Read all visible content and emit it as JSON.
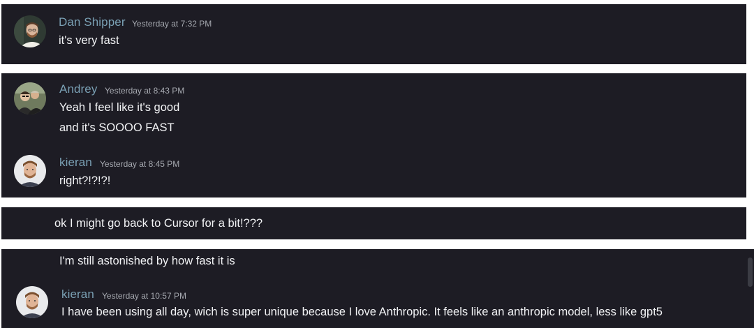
{
  "messages": [
    {
      "author": "Dan Shipper",
      "time": "Yesterday at 7:32 PM",
      "lines": [
        "it's very fast"
      ]
    },
    {
      "author": "Andrey",
      "time": "Yesterday at 8:43 PM",
      "lines": [
        "Yeah I feel like it's good",
        "and it's SOOOO FAST"
      ]
    },
    {
      "author": "kieran",
      "time": "Yesterday at 8:45 PM",
      "lines": [
        "right?!?!?!"
      ]
    },
    {
      "author": "",
      "time": "",
      "lines": [
        "ok I might go back to Cursor for a bit!???"
      ]
    },
    {
      "author": "",
      "time": "",
      "lines": [
        "I'm still astonished by how fast it is"
      ]
    },
    {
      "author": "kieran",
      "time": "Yesterday at 10:57 PM",
      "lines": [
        "I have been using all day, wich is super unique because I love Anthropic. It feels like an anthropic model, less like gpt5"
      ]
    }
  ],
  "colors": {
    "panel_background": "#1d1c24",
    "author_name": "#7aa0b4",
    "timestamp": "#a6a9b0",
    "message_text": "#f2f3f5"
  },
  "icons": {
    "avatars": [
      "avatar-dan-shipper",
      "avatar-andrey",
      "avatar-kieran",
      "avatar-kieran"
    ]
  }
}
